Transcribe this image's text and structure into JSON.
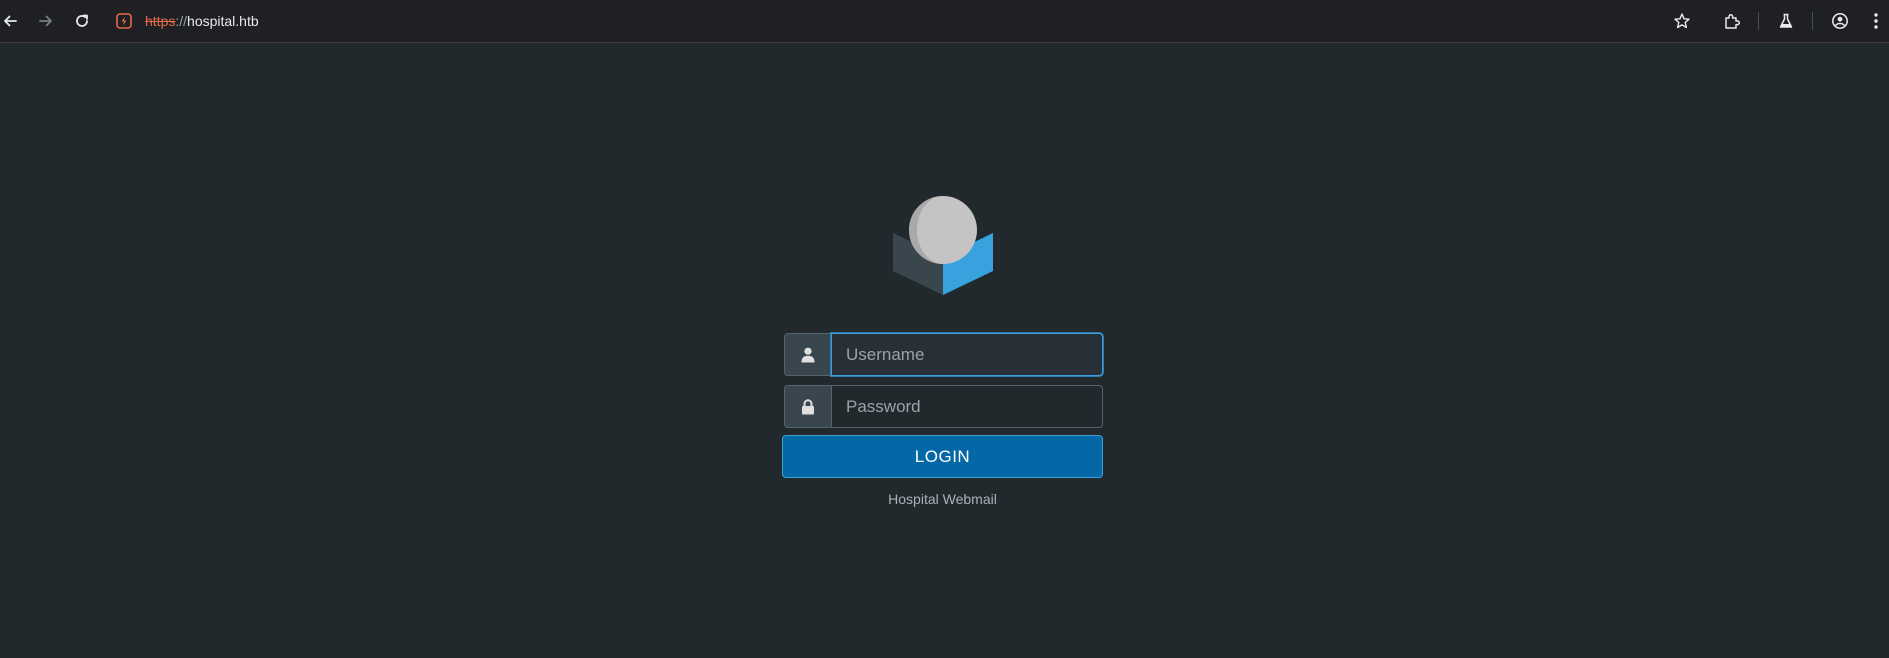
{
  "browser": {
    "url": {
      "scheme": "https",
      "separator": "://",
      "host": "hospital.htb"
    },
    "icons": {
      "back": "arrow-left-icon",
      "forward": "arrow-right-icon",
      "reload": "reload-icon",
      "site_info": "insecure-site-icon",
      "bookmark": "star-icon",
      "extensions": "puzzle-icon",
      "labs": "flask-icon",
      "profile": "account-icon",
      "menu": "kebab-menu-icon"
    }
  },
  "login": {
    "username_placeholder": "Username",
    "password_placeholder": "Password",
    "button_label": "LOGIN",
    "footer": "Hospital Webmail"
  },
  "colors": {
    "background": "#22292d",
    "accent": "#0568a6",
    "logo_blue": "#37a2dd",
    "logo_dark": "#3a464d",
    "logo_sphere": "#c4c4c4"
  }
}
